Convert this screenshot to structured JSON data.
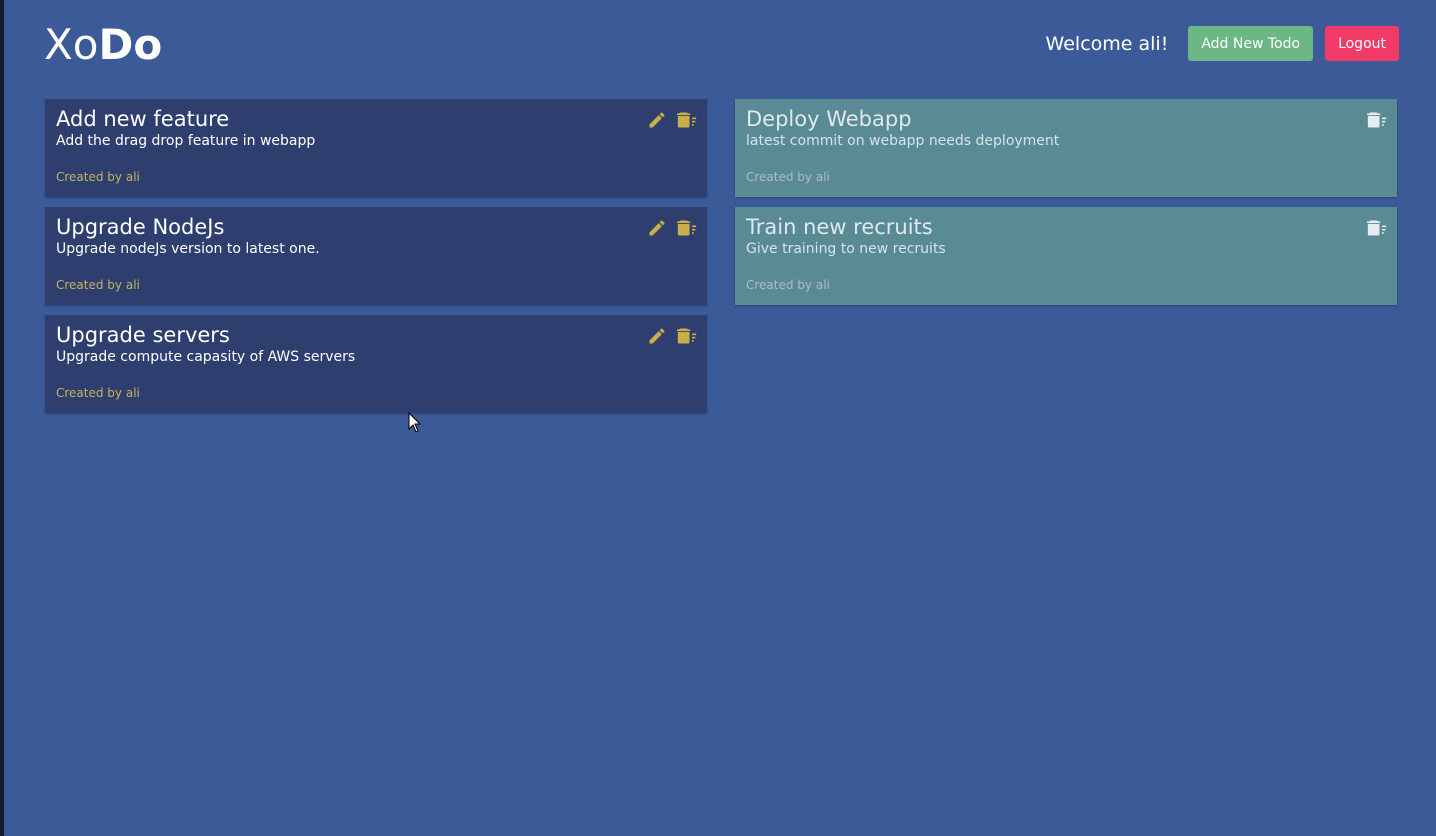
{
  "app": {
    "logo_light": "Xo",
    "logo_bold": "Do"
  },
  "header": {
    "welcome": "Welcome ali!",
    "add_label": "Add New Todo",
    "logout_label": "Logout"
  },
  "colors": {
    "background": "#3c5a98",
    "active_card": "#2e3f6f",
    "done_card": "#5a8a94",
    "add_button": "#6bb886",
    "logout_button": "#f23a66",
    "icon_accent": "#c9b046"
  },
  "todos": [
    {
      "title": "Add new feature",
      "description": "Add the drag drop feature in webapp",
      "meta": "Created by ali",
      "status": "pending"
    },
    {
      "title": "Upgrade NodeJs",
      "description": "Upgrade nodeJs version to latest one.",
      "meta": "Created by ali",
      "status": "pending"
    },
    {
      "title": "Upgrade servers",
      "description": "Upgrade compute capasity of AWS servers",
      "meta": "Created by ali",
      "status": "pending"
    }
  ],
  "completed": [
    {
      "title": "Deploy Webapp",
      "description": "latest commit on webapp needs deployment",
      "meta": "Created by ali",
      "status": "done"
    },
    {
      "title": "Train new recruits",
      "description": "Give training to new recruits",
      "meta": "Created by ali",
      "status": "done"
    }
  ],
  "icons": {
    "edit": "pencil-icon",
    "delete": "delete-sweep-icon"
  }
}
